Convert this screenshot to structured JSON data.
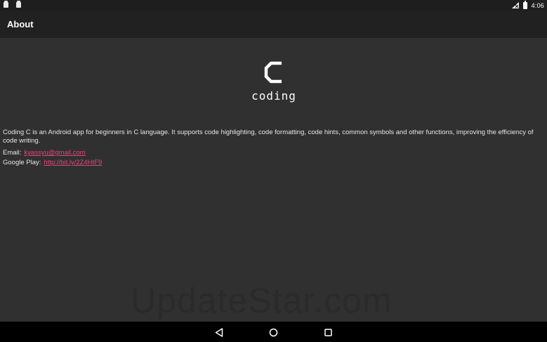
{
  "status_bar": {
    "notification_icons": [
      "notification-icon",
      "notification-icon"
    ],
    "signal_icon": "signal-icon",
    "battery_icon": "battery-icon",
    "time": "4:06"
  },
  "app_bar": {
    "title": "About"
  },
  "logo": {
    "glyph": "C",
    "wordmark": "coding"
  },
  "about": {
    "description": "Coding C is an Android app for beginners in C language. It supports code highlighting, code formatting, code hints, common symbols and other functions, improving the efficiency of code writing.",
    "email_label": "Email:",
    "email_value": "kyassyu@gmail.com",
    "play_label": "Google Play:",
    "play_value": "http://bit.ly/2Z4HtF9"
  },
  "watermark": "UpdateStar.com",
  "nav_bar": {
    "back_icon": "back-icon",
    "home_icon": "home-icon",
    "recents_icon": "recents-icon"
  },
  "colors": {
    "background": "#303030",
    "app_bar": "#212121",
    "status_bar": "#1e1e1e",
    "nav_bar": "#000000",
    "link": "#e2477c"
  }
}
